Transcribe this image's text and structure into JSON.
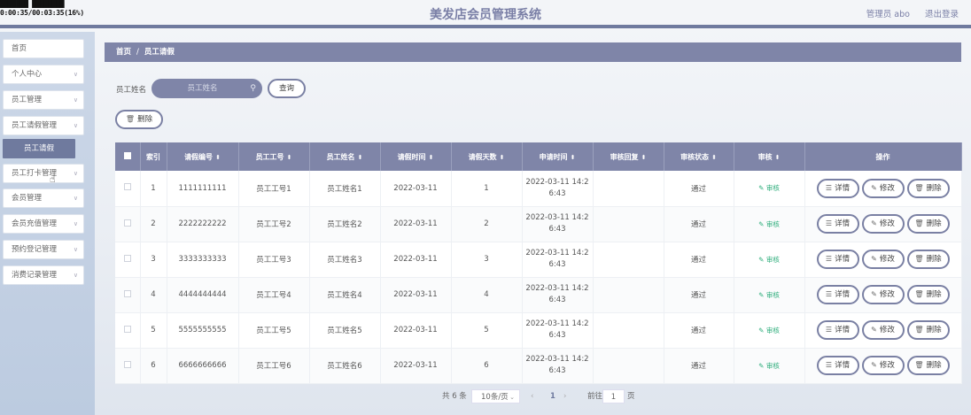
{
  "overlay": {
    "line1": "███████ ████████",
    "line2": "0:00:35/00:03:35(16%)"
  },
  "header": {
    "title": "美发店会员管理系统",
    "user": "管理员 abo",
    "logout": "退出登录"
  },
  "sidebar": {
    "items": [
      {
        "label": "首页",
        "chevron": false
      },
      {
        "label": "个人中心",
        "chevron": true
      },
      {
        "label": "员工管理",
        "chevron": true
      },
      {
        "label": "员工请假管理",
        "chevron": true
      },
      {
        "label": "员工打卡管理",
        "chevron": true
      },
      {
        "label": "会员管理",
        "chevron": true
      },
      {
        "label": "会员充值管理",
        "chevron": true
      },
      {
        "label": "预约登记管理",
        "chevron": true
      },
      {
        "label": "消费记录管理",
        "chevron": true
      }
    ],
    "sub_active": "员工请假"
  },
  "breadcrumb": {
    "home": "首页",
    "sep": "/",
    "current": "员工请假"
  },
  "search": {
    "label": "员工姓名",
    "placeholder": "员工姓名",
    "query_button": "查询"
  },
  "toolbar": {
    "delete_button": "删除"
  },
  "table": {
    "headers": [
      "索引",
      "请假编号",
      "员工工号",
      "员工姓名",
      "请假时间",
      "请假天数",
      "申请时间",
      "审核回复",
      "审核状态",
      "审核",
      "操作"
    ],
    "sortable": [
      false,
      true,
      true,
      true,
      true,
      true,
      true,
      true,
      true,
      true,
      false
    ],
    "audit_label": "审核",
    "ops": {
      "detail": "详情",
      "edit": "修改",
      "delete": "删除"
    },
    "rows": [
      {
        "index": "1",
        "leave_no": "1111111111",
        "emp_no": "员工工号1",
        "emp_name": "员工姓名1",
        "leave_date": "2022-03-11",
        "days": "1",
        "apply_time_1": "2022-03-11 14:2",
        "apply_time_2": "6:43",
        "reply": "",
        "status": "通过"
      },
      {
        "index": "2",
        "leave_no": "2222222222",
        "emp_no": "员工工号2",
        "emp_name": "员工姓名2",
        "leave_date": "2022-03-11",
        "days": "2",
        "apply_time_1": "2022-03-11 14:2",
        "apply_time_2": "6:43",
        "reply": "",
        "status": "通过"
      },
      {
        "index": "3",
        "leave_no": "3333333333",
        "emp_no": "员工工号3",
        "emp_name": "员工姓名3",
        "leave_date": "2022-03-11",
        "days": "3",
        "apply_time_1": "2022-03-11 14:2",
        "apply_time_2": "6:43",
        "reply": "",
        "status": "通过"
      },
      {
        "index": "4",
        "leave_no": "4444444444",
        "emp_no": "员工工号4",
        "emp_name": "员工姓名4",
        "leave_date": "2022-03-11",
        "days": "4",
        "apply_time_1": "2022-03-11 14:2",
        "apply_time_2": "6:43",
        "reply": "",
        "status": "通过"
      },
      {
        "index": "5",
        "leave_no": "5555555555",
        "emp_no": "员工工号5",
        "emp_name": "员工姓名5",
        "leave_date": "2022-03-11",
        "days": "5",
        "apply_time_1": "2022-03-11 14:2",
        "apply_time_2": "6:43",
        "reply": "",
        "status": "通过"
      },
      {
        "index": "6",
        "leave_no": "6666666666",
        "emp_no": "员工工号6",
        "emp_name": "员工姓名6",
        "leave_date": "2022-03-11",
        "days": "6",
        "apply_time_1": "2022-03-11 14:2",
        "apply_time_2": "6:43",
        "reply": "",
        "status": "通过"
      }
    ]
  },
  "pagination": {
    "total": "共 6 条",
    "page_size": "10条/页",
    "current_page": "1",
    "goto_label": "前往",
    "goto_value": "1",
    "page_unit": "页"
  },
  "colors": {
    "accent": "#7f85a8",
    "audit_green": "#2fae7c",
    "sidebar_bg": "#c7d3e6"
  },
  "icons": {
    "search": "search-icon",
    "delete": "trash-icon",
    "detail": "document-icon",
    "edit": "pencil-icon",
    "audit": "pencil-icon",
    "chevron": "chevron-down-icon"
  }
}
